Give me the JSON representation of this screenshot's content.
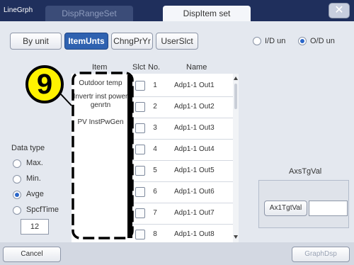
{
  "title_bar": {
    "app_title": "LineGrph",
    "tabs": [
      {
        "label": "DispRangeSet",
        "active": false
      },
      {
        "label": "DispItem set",
        "active": true
      }
    ],
    "close_glyph": "✕"
  },
  "toolbar": {
    "buttons": [
      {
        "label": "By unit",
        "selected": false
      },
      {
        "label": "ItemUnts",
        "selected": true
      },
      {
        "label": "ChngPrYr",
        "selected": false
      },
      {
        "label": "UserSlct",
        "selected": false
      }
    ],
    "radios": [
      {
        "label": "I/D un",
        "selected": false
      },
      {
        "label": "O/D un",
        "selected": true
      }
    ]
  },
  "callout_number": "9",
  "columns": {
    "item": "Item",
    "slct": "Slct",
    "no": "No.",
    "name": "Name"
  },
  "items": [
    "Outdoor temp",
    "Invertr inst power genrtn",
    "PV InstPwGen"
  ],
  "rows": [
    {
      "no": "1",
      "name": "Adp1-1 Out1"
    },
    {
      "no": "2",
      "name": "Adp1-1 Out2"
    },
    {
      "no": "3",
      "name": "Adp1-1 Out3"
    },
    {
      "no": "4",
      "name": "Adp1-1 Out4"
    },
    {
      "no": "5",
      "name": "Adp1-1 Out5"
    },
    {
      "no": "6",
      "name": "Adp1-1 Out6"
    },
    {
      "no": "7",
      "name": "Adp1-1 Out7"
    },
    {
      "no": "8",
      "name": "Adp1-1 Out8"
    }
  ],
  "data_type": {
    "label": "Data type",
    "options": [
      {
        "label": "Max.",
        "selected": false
      },
      {
        "label": "Min.",
        "selected": false
      },
      {
        "label": "Avge",
        "selected": true
      },
      {
        "label": "SpcfTime",
        "selected": false
      }
    ],
    "value": "12"
  },
  "axis_target": {
    "label": "AxsTgVal",
    "button": "Ax1TgtVal",
    "value": ""
  },
  "footer": {
    "cancel": "Cancel",
    "graph": "GraphDsp"
  },
  "colors": {
    "title_bar": "#1f2f5c",
    "accent_blue": "#2f62b0",
    "callout_yellow": "#fff200"
  },
  "icons": [
    "close-icon",
    "scroll-up-icon",
    "scroll-down-icon"
  ]
}
